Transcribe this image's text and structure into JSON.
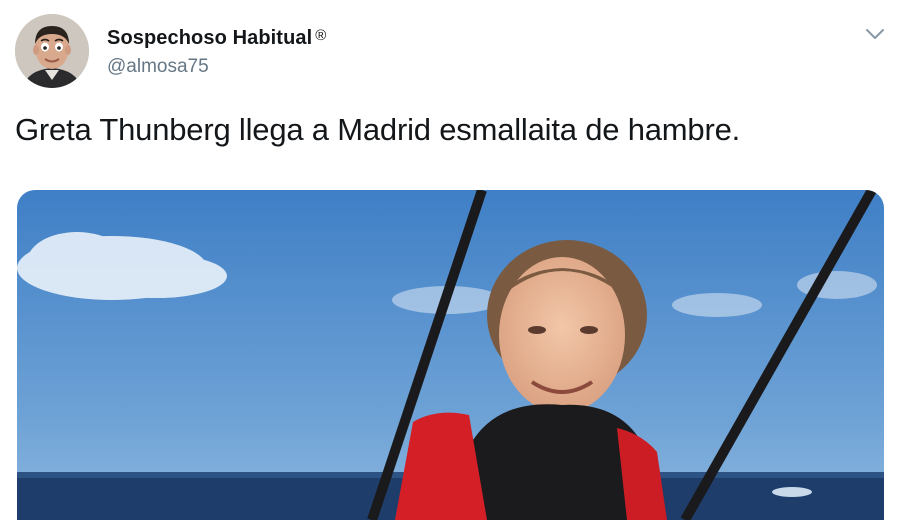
{
  "tweet": {
    "author": {
      "display_name": "Sospechoso Habitual",
      "badge": "®",
      "handle": "@almosa75",
      "avatar_icon": "profile-avatar"
    },
    "text": "Greta Thunberg llega a Madrid esmallaita de hambre.",
    "menu_icon": "chevron-down-icon",
    "media": {
      "type": "photo",
      "icon": "photo-of-girl-on-sailboat"
    }
  },
  "colors": {
    "text_primary": "#14171a",
    "text_secondary": "#657786",
    "chevron": "#8899a6"
  }
}
